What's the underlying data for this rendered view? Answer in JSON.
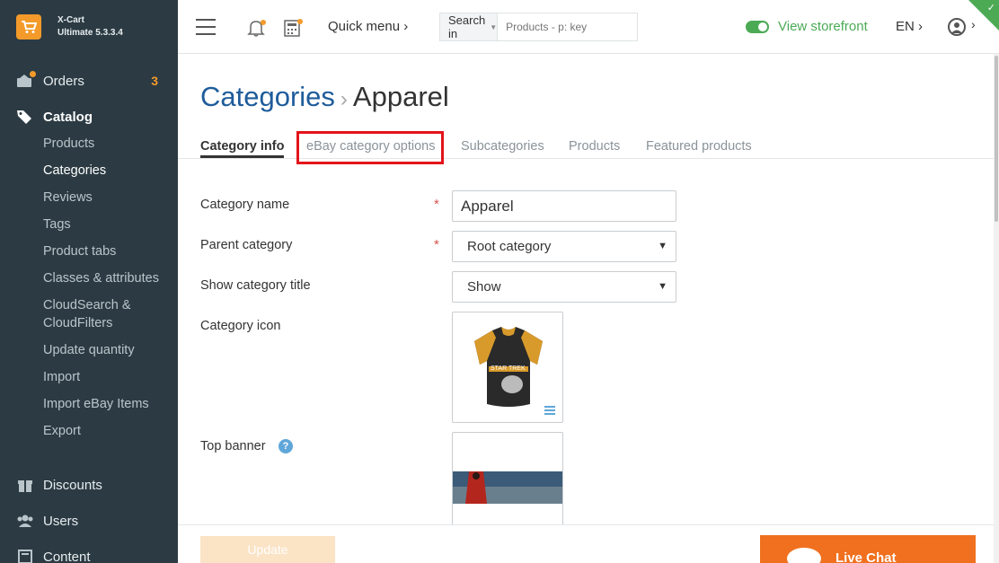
{
  "brand": {
    "name": "X-Cart",
    "version": "Ultimate 5.3.3.4"
  },
  "sidebar": {
    "orders": {
      "label": "Orders",
      "badge": "3"
    },
    "catalog": {
      "label": "Catalog"
    },
    "catalog_items": [
      "Products",
      "Categories",
      "Reviews",
      "Tags",
      "Product tabs",
      "Classes & attributes",
      "CloudSearch &",
      "CloudFilters",
      "Update quantity",
      "Import",
      "Import eBay Items",
      "Export"
    ],
    "discounts": "Discounts",
    "users": "Users",
    "content": "Content"
  },
  "header": {
    "quick_menu": "Quick menu ›",
    "search_in": "Search in",
    "search_placeholder": "Products - p: key",
    "storefront": "View storefront",
    "lang": "EN ›",
    "user_chevron": "›"
  },
  "page": {
    "breadcrumb_root": "Categories",
    "breadcrumb_sep": "›",
    "title": "Apparel"
  },
  "tabs": [
    "Category info",
    "eBay category options",
    "Subcategories",
    "Products",
    "Featured products"
  ],
  "form": {
    "category_name_label": "Category name",
    "category_name_value": "Apparel",
    "parent_category_label": "Parent category",
    "parent_category_value": "Root category",
    "show_title_label": "Show category title",
    "show_title_value": "Show",
    "category_icon_label": "Category icon",
    "top_banner_label": "Top banner",
    "required_mark": "*",
    "help_mark": "?"
  },
  "actions": {
    "update": "Update",
    "live_chat": "Live Chat"
  },
  "colors": {
    "sidebar_bg": "#2c3b43",
    "accent": "#f39a2a",
    "link": "#1e5c9b",
    "green": "#4caa55",
    "highlight": "#e3141b",
    "chat": "#f0701f"
  }
}
